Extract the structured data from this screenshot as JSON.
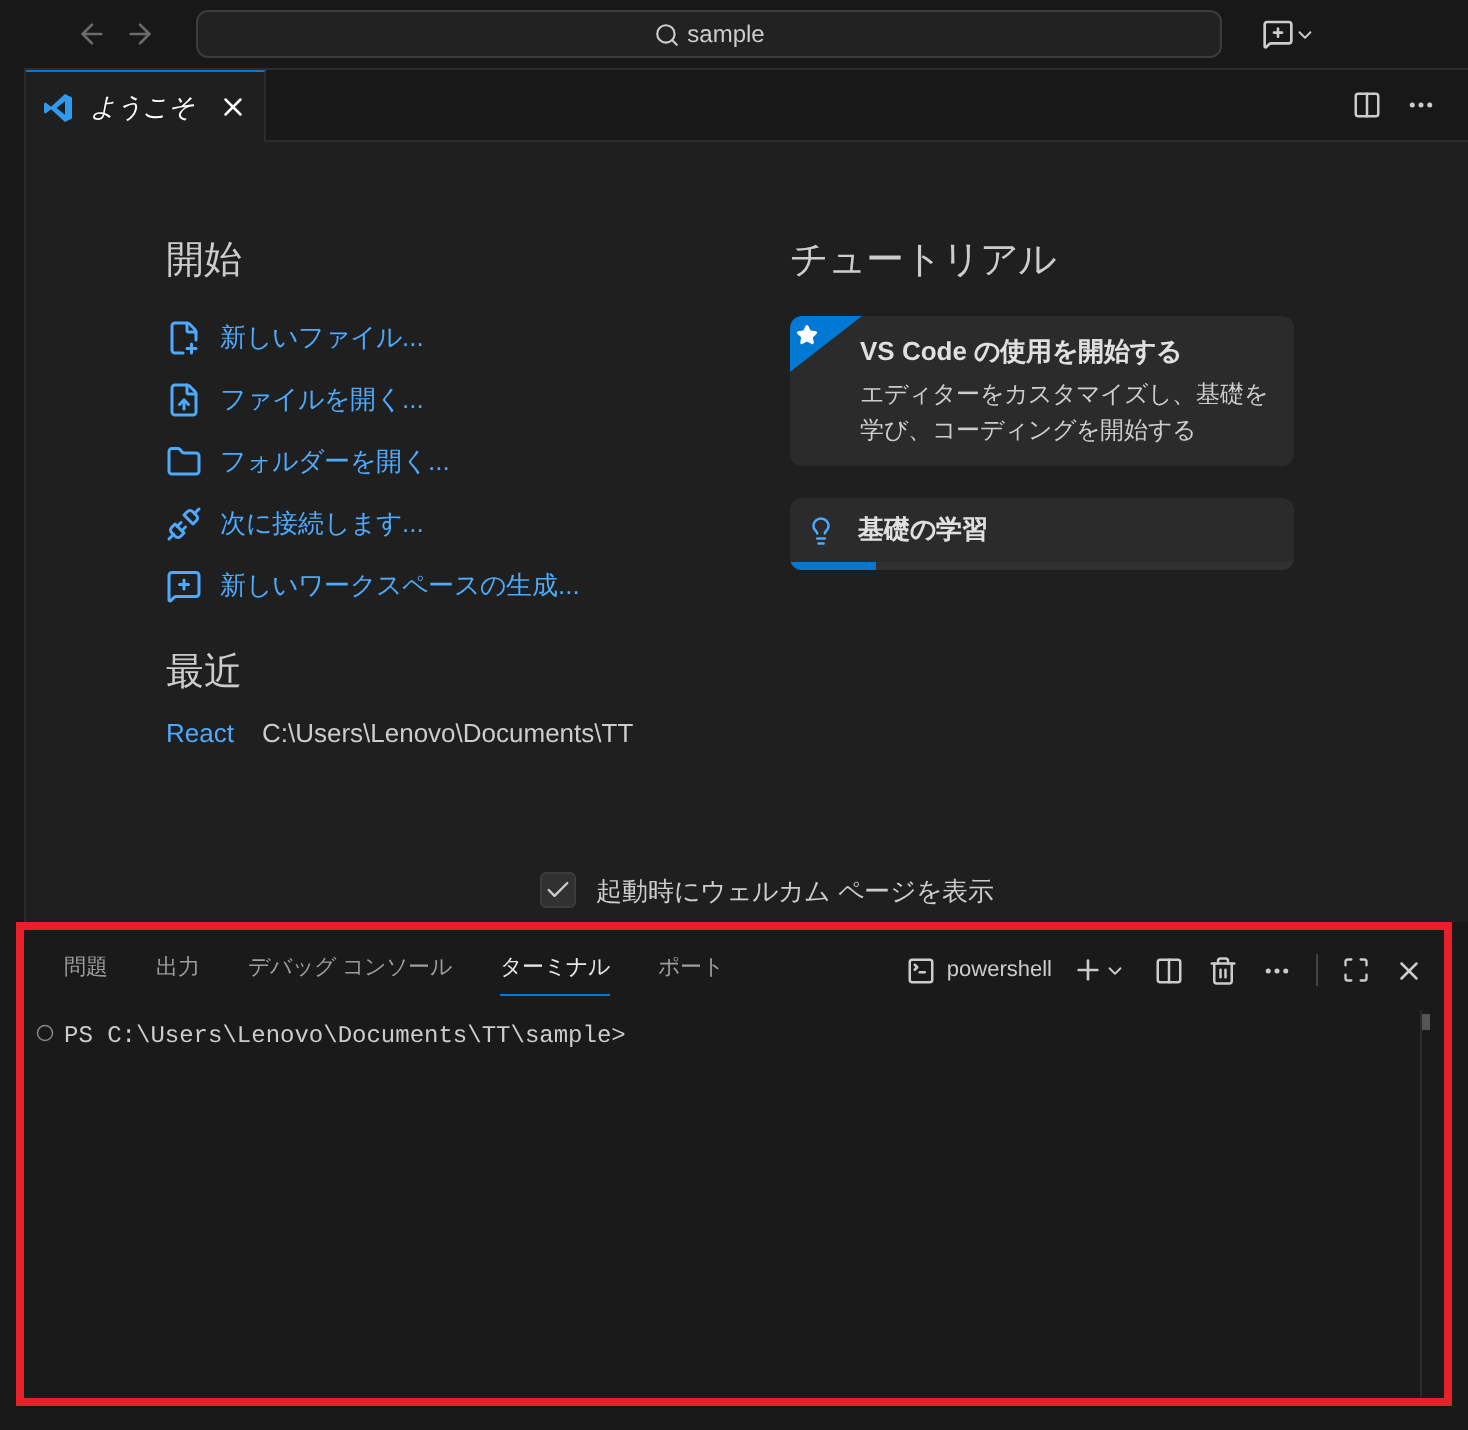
{
  "title_bar": {
    "search": "sample"
  },
  "tabs": [
    {
      "label": "ようこそ",
      "selected": true
    }
  ],
  "start": {
    "heading": "開始",
    "actions": [
      {
        "kind": "new-file",
        "label": "新しいファイル..."
      },
      {
        "kind": "open-file",
        "label": "ファイルを開く..."
      },
      {
        "kind": "open-folder",
        "label": "フォルダーを開く..."
      },
      {
        "kind": "connect",
        "label": "次に接続します..."
      },
      {
        "kind": "workspace",
        "label": "新しいワークスペースの生成..."
      }
    ]
  },
  "recent": {
    "heading": "最近",
    "items": [
      {
        "name": "React",
        "path": "C:\\Users\\Lenovo\\Documents\\TT"
      }
    ]
  },
  "tutorials": {
    "heading": "チュートリアル",
    "items": [
      {
        "kind": "featured",
        "title": "VS Code の使用を開始する",
        "description": "エディターをカスタマイズし、基礎を学び、コーディングを開始する"
      },
      {
        "kind": "progress",
        "title": "基礎の学習",
        "level": 0.17
      }
    ]
  },
  "show_on_startup": {
    "label": "起動時にウェルカム ページを表示",
    "checked": true
  },
  "panel": {
    "highlighted": true,
    "tabs": [
      {
        "label": "問題",
        "selected": false
      },
      {
        "label": "出力",
        "selected": false
      },
      {
        "label": "デバッグ コンソール",
        "selected": false
      },
      {
        "label": "ターミナル",
        "selected": true
      },
      {
        "label": "ポート",
        "selected": false
      }
    ],
    "terminal_name": "powershell",
    "prompt": "PS C:\\Users\\Lenovo\\Documents\\TT\\sample>"
  }
}
